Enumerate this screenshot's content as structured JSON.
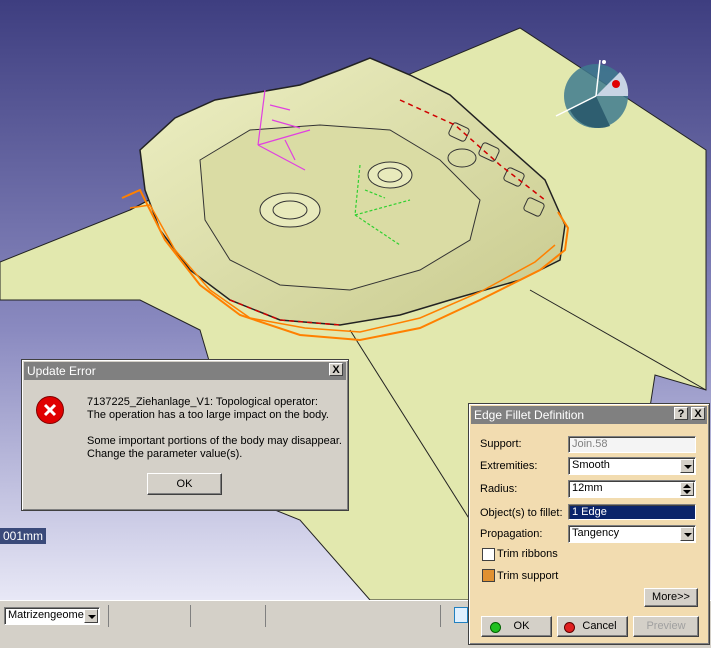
{
  "scale_readout": "001mm",
  "update_error": {
    "title": "Update Error",
    "line1": "7137225_Ziehanlage_V1: Topological operator:",
    "line2": "The operation has a too large impact on the body.",
    "line3": "Some important portions of the body may disappear.",
    "line4": "Change the parameter value(s).",
    "ok_label": "OK",
    "close_label": "X"
  },
  "fillet_dialog": {
    "title": "Edge Fillet Definition",
    "help_label": "?",
    "close_label": "X",
    "support_label": "Support:",
    "support_value": "Join.58",
    "extremities_label": "Extremities:",
    "extremities_value": "Smooth",
    "radius_label": "Radius:",
    "radius_value": "12mm",
    "objects_label": "Object(s) to fillet:",
    "objects_value": "1 Edge",
    "propagation_label": "Propagation:",
    "propagation_value": "Tangency",
    "trim_ribbons_label": "Trim ribbons",
    "trim_ribbons_checked": false,
    "trim_support_label": "Trim support",
    "trim_support_checked": true,
    "more_label": "More>>",
    "ok_label": "OK",
    "cancel_label": "Cancel",
    "preview_label": "Preview"
  },
  "bottom_bar": {
    "geometry_select_value": "Matrizengeomet"
  },
  "colors": {
    "viewport_bg_top": "#4a4a8a",
    "viewport_bg_bottom": "#d8d8ee",
    "part_fill": "#e6e8b4",
    "sheet_fill": "#e4eab0",
    "highlight_orange": "#ff8000",
    "title_active": "#0a246a",
    "title_inactive": "#808080"
  }
}
